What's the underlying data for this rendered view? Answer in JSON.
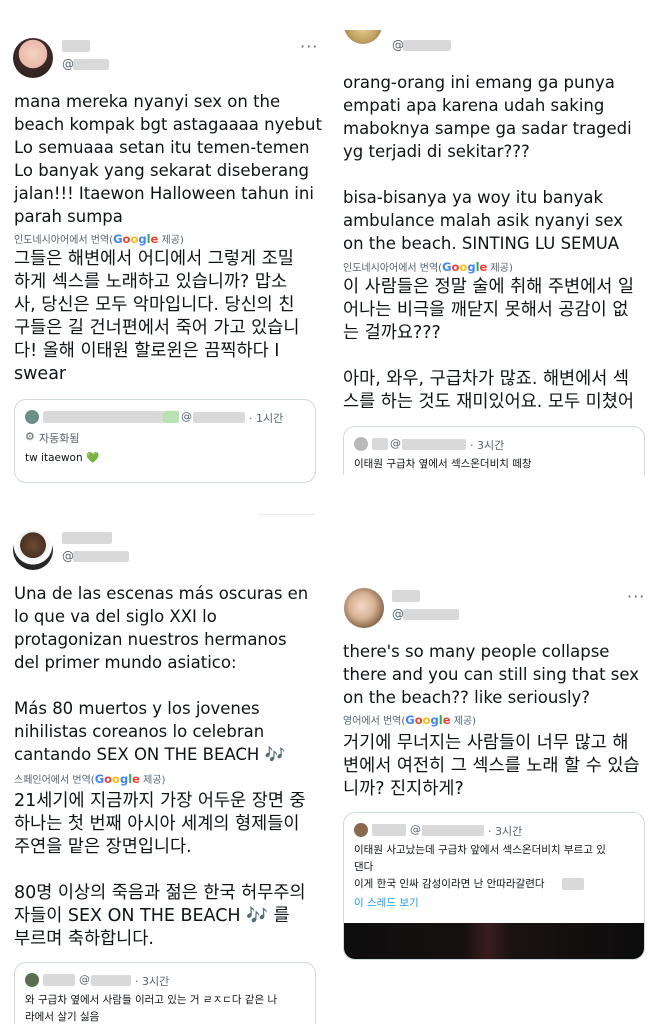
{
  "tweets": [
    {
      "handle": "@",
      "text": "mana mereka nyanyi sex on the\nbeach kompak bgt astagaaaa nyebut\nLo semuaaa setan itu temen-temen\nLo banyak yang sekarat diseberang\njalan!!! Itaewon Halloween tahun ini\nparah sumpa",
      "translate_label": "인도네시아어에서 번역(",
      "translate_suffix": " 제공)",
      "translation": "그들은 해변에서 어디에서 그렇게 조밀\n하게 섹스를 노래하고 있습니까? 맙소\n사, 당신은 모두 악마입니다. 당신의 친\n구들은 길 건너편에서 죽어 가고 있습니\n다! 올해 이태원 할로윈은 끔찍하다 I\nswear",
      "quote": {
        "handle": "@",
        "time": "· 1시간",
        "auto_label": "자동화됨",
        "text": "tw itaewon 💚"
      }
    },
    {
      "handle": "@",
      "text": "orang-orang ini emang ga punya\nempati apa karena udah saking\nmaboknya sampe ga sadar tragedi\nyg terjadi di sekitar???\n\nbisa-bisanya ya woy itu banyak\nambulance malah asik nyanyi sex\non the beach. SINTING LU SEMUA",
      "translate_label": "인도네시아어에서 번역(",
      "translate_suffix": " 제공)",
      "translation": "이 사람들은 정말 술에 취해 주변에서 일\n어나는 비극을 깨닫지 못해서 공감이 없\n는 걸까요???\n\n아마, 와우, 구급차가 많죠. 해변에서 섹\n스를 하는 것도 재미있어요. 모두 미쳤어",
      "quote": {
        "handle": "@",
        "time": "· 3시간",
        "text": "이태원 구급차 옆에서 섹스온더비치 떼창"
      }
    },
    {
      "handle": "@",
      "text": "Una de las escenas más oscuras en\nlo que va del siglo XXI lo\nprotagonizan nuestros hermanos\ndel primer mundo asiatico:\n\nMás 80 muertos y los jovenes\nnihilistas coreanos lo celebran\ncantando SEX ON THE BEACH 🎶",
      "translate_label": "스페인어에서 번역(",
      "translate_suffix": " 제공)",
      "translation": "21세기에 지금까지 가장 어두운 장면 중\n하나는 첫 번째 아시아 세계의 형제들이\n주연을 맡은 장면입니다.\n\n80명 이상의 죽음과 젊은 한국 허무주의\n자들이 SEX ON THE BEACH 🎶 를\n부르며 축하합니다.",
      "quote": {
        "handle": "@",
        "time": "· 3시간",
        "text": "와 구급차 옆에서 사람들 이러고 있는 거 ㄹㅈㄷ다 같은 나\n라에서 살기 싫음"
      }
    },
    {
      "handle": "@",
      "text": "there's so many people collapse\nthere and you can still sing that sex\non the beach?? like seriously?",
      "translate_label": "영어에서 번역(",
      "translate_suffix": " 제공)",
      "translation": "거기에 무너지는 사람들이 너무 많고 해\n변에서 여전히 그 섹스를 노래 할 수 있습\n니까? 진지하게?",
      "quote": {
        "handle": "@",
        "time": "· 3시간",
        "text": "이태원 사고났는데 구급차 앞에서 섹스온더비치 부르고 있\n댄다\n이게 한국 인싸 감성이라면 난 안따라갈련다",
        "thread_link": "이 스레드 보기"
      }
    }
  ],
  "google_letters": [
    "G",
    "o",
    "o",
    "g",
    "l",
    "e"
  ],
  "more_icon": "···"
}
